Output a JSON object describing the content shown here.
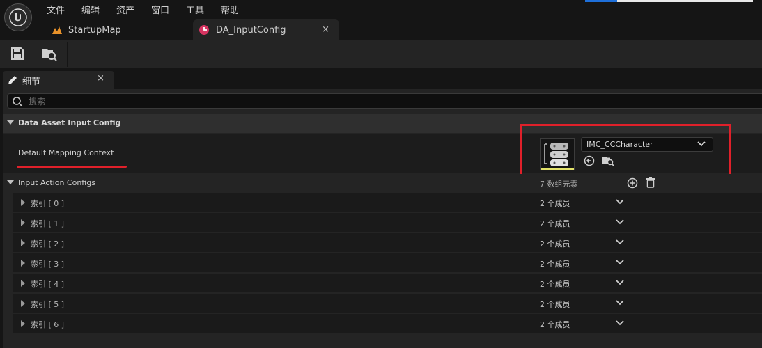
{
  "menu": {
    "items": [
      "文件",
      "编辑",
      "资产",
      "窗口",
      "工具",
      "帮助"
    ]
  },
  "tabs": [
    {
      "label": "StartupMap",
      "icon": "level-map-icon"
    },
    {
      "label": "DA_InputConfig",
      "icon": "data-asset-icon",
      "close": "×"
    }
  ],
  "toolbar": {
    "save_icon": "save-icon",
    "browse_icon": "browse-content-icon"
  },
  "details": {
    "tab_label": "细节",
    "tab_close": "×",
    "search_placeholder": "搜索",
    "category": "Data Asset Input Config",
    "mapping_label": "Default Mapping Context",
    "mapping_value": "IMC_CCCharacter",
    "array_label": "Input Action Configs",
    "array_count": "7 数组元素",
    "rows": [
      {
        "label": "索引 [ 0 ]",
        "count": "2 个成员"
      },
      {
        "label": "索引 [ 1 ]",
        "count": "2 个成员"
      },
      {
        "label": "索引 [ 2 ]",
        "count": "2 个成员"
      },
      {
        "label": "索引 [ 3 ]",
        "count": "2 个成员"
      },
      {
        "label": "索引 [ 4 ]",
        "count": "2 个成员"
      },
      {
        "label": "索引 [ 5 ]",
        "count": "2 个成员"
      },
      {
        "label": "索引 [ 6 ]",
        "count": "2 个成员"
      }
    ]
  },
  "colors": {
    "highlight_red": "#e0202a",
    "thumbnail_bar": "#e3e36a",
    "panel_bg": "#242424",
    "window_bg": "#151515"
  }
}
